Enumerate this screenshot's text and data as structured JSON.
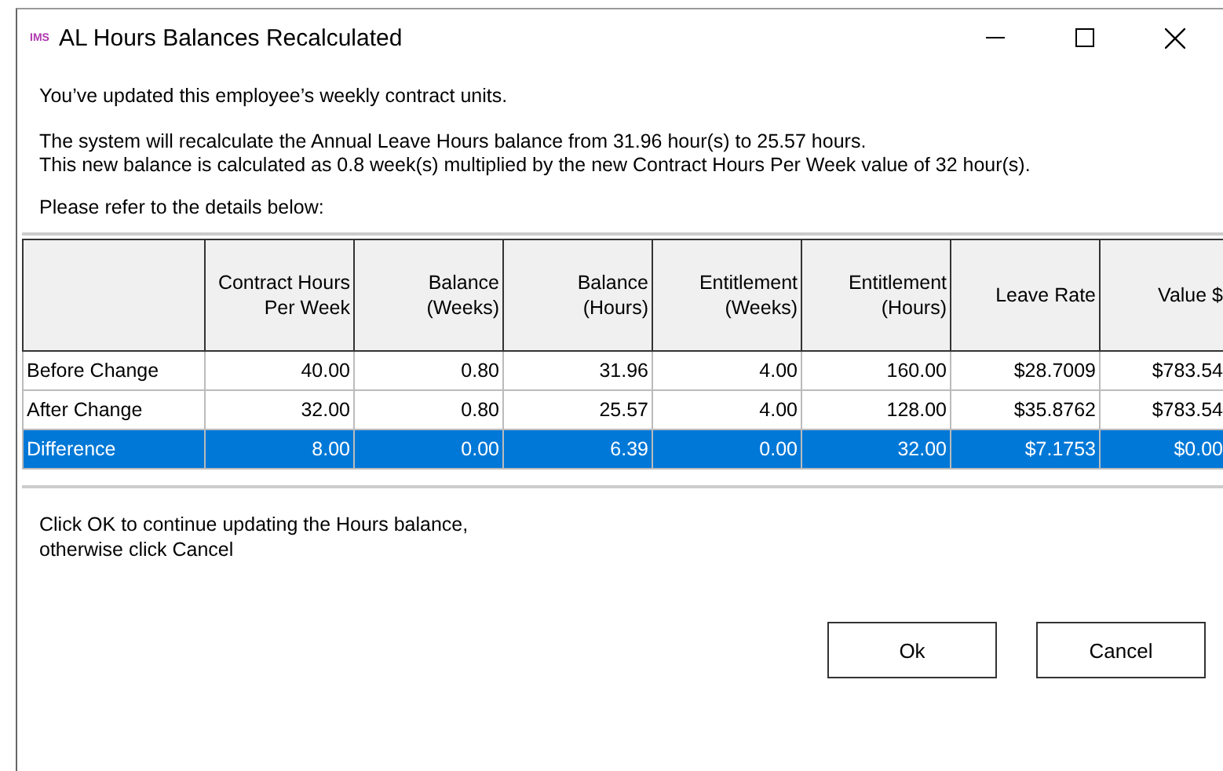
{
  "window": {
    "logo": "IMS",
    "title": "AL Hours Balances Recalculated"
  },
  "intro": "You’ve updated this employee’s weekly contract units.",
  "explanation": [
    "The system will recalculate the Annual Leave Hours balance from 31.96 hour(s) to 25.57 hours.",
    "This new balance is calculated as 0.8 week(s) multiplied by the new Contract Hours Per Week value of 32 hour(s)."
  ],
  "details_label": "Please refer to the details below:",
  "table": {
    "columns": [
      "",
      "Contract Hours Per Week",
      "Balance (Weeks)",
      "Balance (Hours)",
      "Entitlement (Weeks)",
      "Entitlement (Hours)",
      "Leave Rate",
      "Value $"
    ],
    "rows": [
      {
        "selected": false,
        "cells": [
          "Before Change",
          "40.00",
          "0.80",
          "31.96",
          "4.00",
          "160.00",
          "$28.7009",
          "$783.54"
        ]
      },
      {
        "selected": false,
        "cells": [
          "After Change",
          "32.00",
          "0.80",
          "25.57",
          "4.00",
          "128.00",
          "$35.8762",
          "$783.54"
        ]
      },
      {
        "selected": true,
        "cells": [
          "Difference",
          "8.00",
          "0.00",
          "6.39",
          "0.00",
          "32.00",
          "$7.1753",
          "$0.00"
        ]
      }
    ]
  },
  "footer": [
    "Click OK to continue updating the Hours balance,",
    "otherwise click Cancel"
  ],
  "buttons": [
    "Ok",
    "Cancel"
  ]
}
